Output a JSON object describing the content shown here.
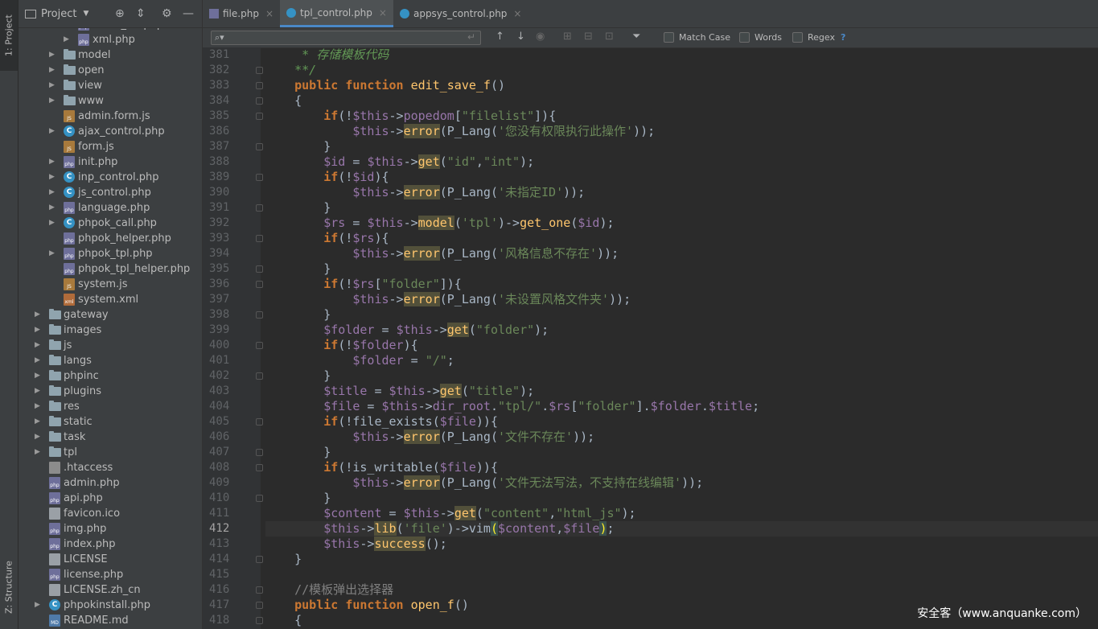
{
  "left_strip": {
    "project_tab": "1: Project",
    "structure_tab": "Z: Structure"
  },
  "project_panel": {
    "title": "Project",
    "tree": [
      {
        "name": "video_url.php",
        "type": "php",
        "indent": 3,
        "arrow": true
      },
      {
        "name": "xml.php",
        "type": "php",
        "indent": 3,
        "arrow": true
      },
      {
        "name": "model",
        "type": "folder",
        "indent": 2,
        "arrow": true
      },
      {
        "name": "open",
        "type": "folder",
        "indent": 2,
        "arrow": true
      },
      {
        "name": "view",
        "type": "folder",
        "indent": 2,
        "arrow": true
      },
      {
        "name": "www",
        "type": "folder",
        "indent": 2,
        "arrow": true
      },
      {
        "name": "admin.form.js",
        "type": "js",
        "indent": 2,
        "arrow": false
      },
      {
        "name": "ajax_control.php",
        "type": "cls",
        "indent": 2,
        "arrow": true
      },
      {
        "name": "form.js",
        "type": "js",
        "indent": 2,
        "arrow": false
      },
      {
        "name": "init.php",
        "type": "php",
        "indent": 2,
        "arrow": true
      },
      {
        "name": "inp_control.php",
        "type": "cls",
        "indent": 2,
        "arrow": true
      },
      {
        "name": "js_control.php",
        "type": "cls",
        "indent": 2,
        "arrow": true
      },
      {
        "name": "language.php",
        "type": "php",
        "indent": 2,
        "arrow": true
      },
      {
        "name": "phpok_call.php",
        "type": "cls",
        "indent": 2,
        "arrow": true
      },
      {
        "name": "phpok_helper.php",
        "type": "php",
        "indent": 2,
        "arrow": false
      },
      {
        "name": "phpok_tpl.php",
        "type": "php",
        "indent": 2,
        "arrow": true
      },
      {
        "name": "phpok_tpl_helper.php",
        "type": "php",
        "indent": 2,
        "arrow": false
      },
      {
        "name": "system.js",
        "type": "js",
        "indent": 2,
        "arrow": false
      },
      {
        "name": "system.xml",
        "type": "xml",
        "indent": 2,
        "arrow": false
      },
      {
        "name": "gateway",
        "type": "folder",
        "indent": 1,
        "arrow": true
      },
      {
        "name": "images",
        "type": "folder",
        "indent": 1,
        "arrow": true
      },
      {
        "name": "js",
        "type": "folder",
        "indent": 1,
        "arrow": true
      },
      {
        "name": "langs",
        "type": "folder",
        "indent": 1,
        "arrow": true
      },
      {
        "name": "phpinc",
        "type": "folder",
        "indent": 1,
        "arrow": true
      },
      {
        "name": "plugins",
        "type": "folder",
        "indent": 1,
        "arrow": true
      },
      {
        "name": "res",
        "type": "folder",
        "indent": 1,
        "arrow": true
      },
      {
        "name": "static",
        "type": "folder",
        "indent": 1,
        "arrow": true
      },
      {
        "name": "task",
        "type": "folder",
        "indent": 1,
        "arrow": true
      },
      {
        "name": "tpl",
        "type": "folder",
        "indent": 1,
        "arrow": true
      },
      {
        "name": ".htaccess",
        "type": "cfg",
        "indent": 1,
        "arrow": false
      },
      {
        "name": "admin.php",
        "type": "php",
        "indent": 1,
        "arrow": false
      },
      {
        "name": "api.php",
        "type": "php",
        "indent": 1,
        "arrow": false
      },
      {
        "name": "favicon.ico",
        "type": "txt",
        "indent": 1,
        "arrow": false
      },
      {
        "name": "img.php",
        "type": "php",
        "indent": 1,
        "arrow": false
      },
      {
        "name": "index.php",
        "type": "php",
        "indent": 1,
        "arrow": false
      },
      {
        "name": "LICENSE",
        "type": "txt",
        "indent": 1,
        "arrow": false
      },
      {
        "name": "license.php",
        "type": "php",
        "indent": 1,
        "arrow": false
      },
      {
        "name": "LICENSE.zh_cn",
        "type": "txt",
        "indent": 1,
        "arrow": false
      },
      {
        "name": "phpokinstall.php",
        "type": "cls",
        "indent": 1,
        "arrow": true
      },
      {
        "name": "README.md",
        "type": "md",
        "indent": 1,
        "arrow": false
      }
    ]
  },
  "tabs": [
    {
      "label": "file.php",
      "icon": "php",
      "active": false
    },
    {
      "label": "tpl_control.php",
      "icon": "cls",
      "active": true
    },
    {
      "label": "appsys_control.php",
      "icon": "cls",
      "active": false
    }
  ],
  "search": {
    "value": "",
    "match_case_label": "Match Case",
    "words_label": "Words",
    "regex_label": "Regex",
    "help": "?"
  },
  "editor": {
    "current_line": "412",
    "lines": [
      {
        "n": "381",
        "html": "     <span class=\"cm\">* 存储模板代码</span>"
      },
      {
        "n": "382",
        "html": "    <span class=\"cm\">**/</span>"
      },
      {
        "n": "383",
        "html": "    <span class=\"kw\">public function</span> <span class=\"fn\">edit_save_f</span>()"
      },
      {
        "n": "384",
        "html": "    {"
      },
      {
        "n": "385",
        "html": "        <span class=\"kw\">if</span>(!<span class=\"var\">$this</span>-><span class=\"var\">popedom</span>[<span class=\"str\">\"filelist\"</span>]){"
      },
      {
        "n": "386",
        "html": "            <span class=\"var\">$this</span>-><span class=\"hl\">error</span>(P_Lang(<span class=\"str\">'您没有权限执行此操作'</span>));"
      },
      {
        "n": "387",
        "html": "        }"
      },
      {
        "n": "388",
        "html": "        <span class=\"var\">$id</span> = <span class=\"var\">$this</span>-><span class=\"hl\">get</span>(<span class=\"str\">\"id\"</span>,<span class=\"str\">\"int\"</span>);"
      },
      {
        "n": "389",
        "html": "        <span class=\"kw\">if</span>(!<span class=\"var\">$id</span>){"
      },
      {
        "n": "390",
        "html": "            <span class=\"var\">$this</span>-><span class=\"hl\">error</span>(P_Lang(<span class=\"str\">'未指定ID'</span>));"
      },
      {
        "n": "391",
        "html": "        }"
      },
      {
        "n": "392",
        "html": "        <span class=\"var\">$rs</span> = <span class=\"var\">$this</span>-><span class=\"hl\">model</span>(<span class=\"str\">'tpl'</span>)-><span class=\"fn\">get_one</span>(<span class=\"var\">$id</span>);"
      },
      {
        "n": "393",
        "html": "        <span class=\"kw\">if</span>(!<span class=\"var\">$rs</span>){"
      },
      {
        "n": "394",
        "html": "            <span class=\"var\">$this</span>-><span class=\"hl\">error</span>(P_Lang(<span class=\"str\">'风格信息不存在'</span>));"
      },
      {
        "n": "395",
        "html": "        }"
      },
      {
        "n": "396",
        "html": "        <span class=\"kw\">if</span>(!<span class=\"var\">$rs</span>[<span class=\"str\">\"folder\"</span>]){"
      },
      {
        "n": "397",
        "html": "            <span class=\"var\">$this</span>-><span class=\"hl\">error</span>(P_Lang(<span class=\"str\">'未设置风格文件夹'</span>));"
      },
      {
        "n": "398",
        "html": "        }"
      },
      {
        "n": "399",
        "html": "        <span class=\"var\">$folder</span> = <span class=\"var\">$this</span>-><span class=\"hl\">get</span>(<span class=\"str\">\"folder\"</span>);"
      },
      {
        "n": "400",
        "html": "        <span class=\"kw\">if</span>(!<span class=\"var\">$folder</span>){"
      },
      {
        "n": "401",
        "html": "            <span class=\"var\">$folder</span> = <span class=\"str\">\"/\"</span>;"
      },
      {
        "n": "402",
        "html": "        }"
      },
      {
        "n": "403",
        "html": "        <span class=\"var\">$title</span> = <span class=\"var\">$this</span>-><span class=\"hl\">get</span>(<span class=\"str\">\"title\"</span>);"
      },
      {
        "n": "404",
        "html": "        <span class=\"var\">$file</span> = <span class=\"var\">$this</span>-><span class=\"var\">dir_root</span>.<span class=\"str\">\"tpl/\"</span>.<span class=\"var\">$rs</span>[<span class=\"str\">\"folder\"</span>].<span class=\"var\">$folder</span>.<span class=\"var\">$title</span>;"
      },
      {
        "n": "405",
        "html": "        <span class=\"kw\">if</span>(!file_exists(<span class=\"var\">$file</span>)){"
      },
      {
        "n": "406",
        "html": "            <span class=\"var\">$this</span>-><span class=\"hl\">error</span>(P_Lang(<span class=\"str\">'文件不存在'</span>));"
      },
      {
        "n": "407",
        "html": "        }"
      },
      {
        "n": "408",
        "html": "        <span class=\"kw\">if</span>(!is_writable(<span class=\"var\">$file</span>)){"
      },
      {
        "n": "409",
        "html": "            <span class=\"var\">$this</span>-><span class=\"hl\">error</span>(P_Lang(<span class=\"str\">'文件无法写法，不支持在线编辑'</span>));"
      },
      {
        "n": "410",
        "html": "        }"
      },
      {
        "n": "411",
        "html": "        <span class=\"var\">$content</span> = <span class=\"var\">$this</span>-><span class=\"hl\">get</span>(<span class=\"str\">\"content\"</span>,<span class=\"str\">\"html_js\"</span>);"
      },
      {
        "n": "412",
        "html": "        <span class=\"var\">$this</span>-><span class=\"hl\">lib</span>(<span class=\"str\">'file'</span>)->vim<span class=\"br\">(</span><span class=\"var\">$content</span>,<span class=\"var\">$file</span><span class=\"br\">)</span>;"
      },
      {
        "n": "413",
        "html": "        <span class=\"var\">$this</span>-><span class=\"hl\">success</span>();"
      },
      {
        "n": "414",
        "html": "    }"
      },
      {
        "n": "415",
        "html": ""
      },
      {
        "n": "416",
        "html": "    <span class=\"cm2\">//模板弹出选择器</span>"
      },
      {
        "n": "417",
        "html": "    <span class=\"kw\">public function</span> <span class=\"fn\">open_f</span>()"
      },
      {
        "n": "418",
        "html": "    {"
      }
    ]
  },
  "watermark": "安全客（www.anquanke.com）"
}
